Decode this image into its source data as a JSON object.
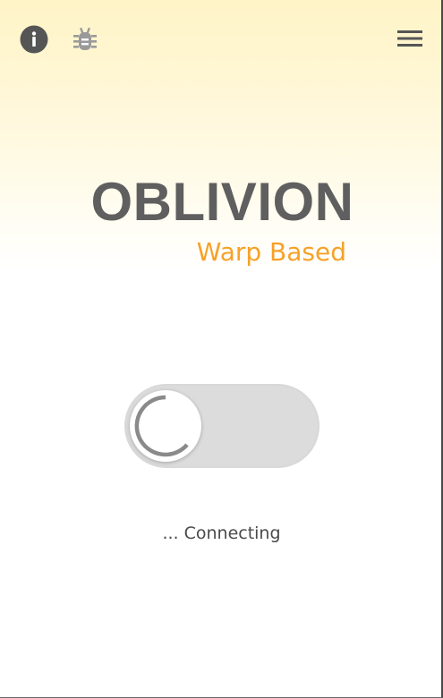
{
  "app": {
    "title": "OBLIVION",
    "subtitle": "Warp Based"
  },
  "toolbar": {
    "left_icons": [
      "info-icon",
      "bug-icon"
    ],
    "right_icons": [
      "menu-icon"
    ]
  },
  "connection": {
    "state": "connecting",
    "status_text": "... Connecting",
    "toggle_on": false
  },
  "colors": {
    "title": "#5f5f5f",
    "accent": "#f7a128",
    "icon_dark": "#555555",
    "icon_muted": "#9a9a9a",
    "toggle_track": "#dcdcdc",
    "spinner": "#8a8a8a",
    "header_gradient": "#fff4c7"
  }
}
